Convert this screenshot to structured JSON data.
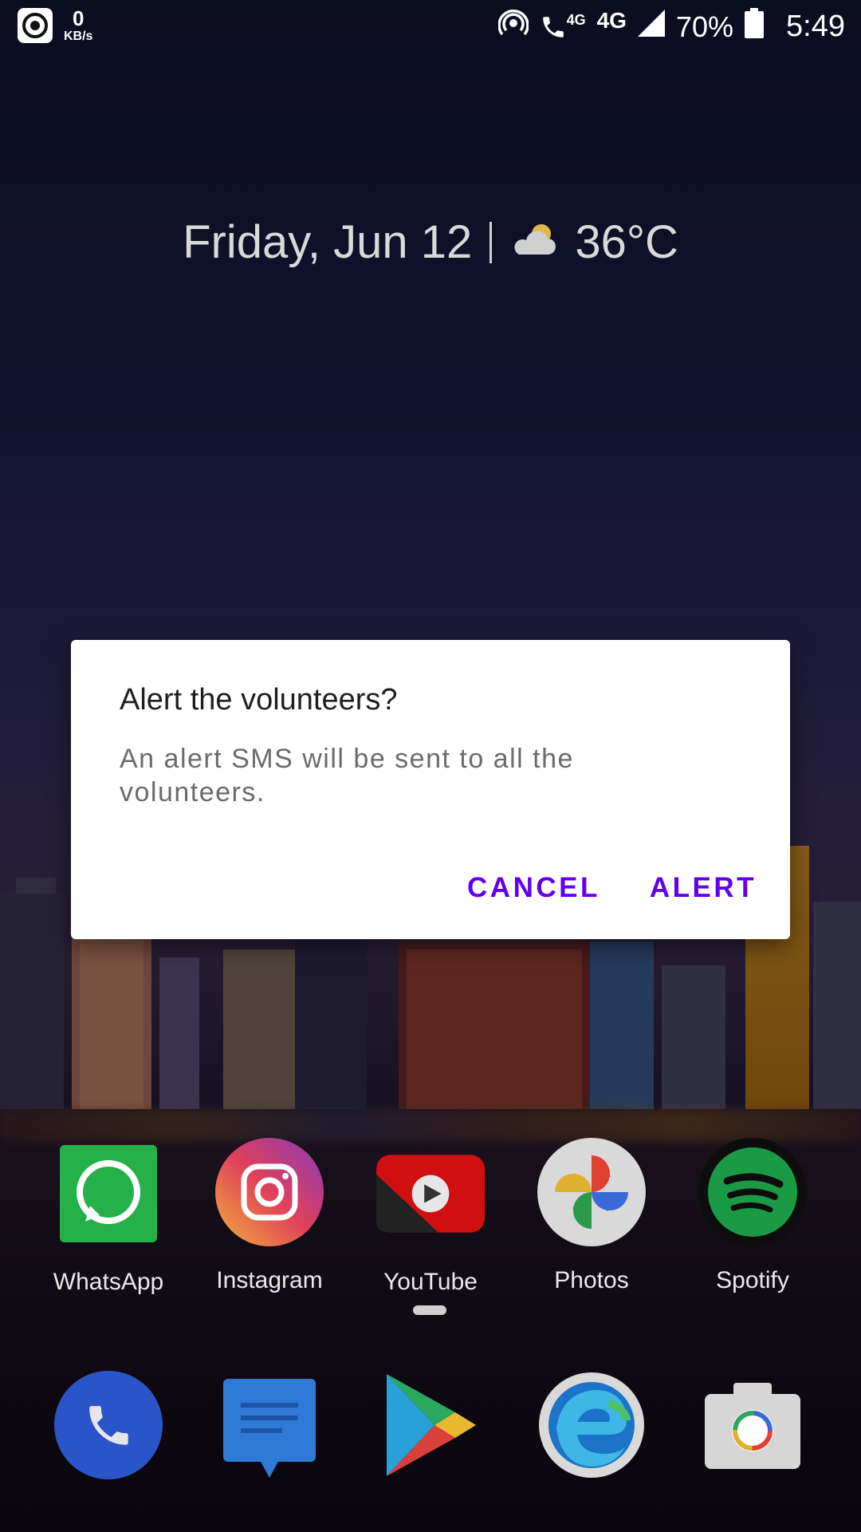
{
  "status_bar": {
    "speed_value": "0",
    "speed_unit": "KB/s",
    "call_net": "4G",
    "network": "4G",
    "battery": "70%",
    "time": "5:49"
  },
  "widget": {
    "date": "Friday, Jun 12",
    "temperature": "36°C",
    "weather_icon": "partly-cloudy-icon"
  },
  "dialog": {
    "title": "Alert the volunteers?",
    "message": "An alert SMS will be sent to all the volunteers.",
    "cancel_label": "CANCEL",
    "confirm_label": "ALERT",
    "accent_color": "#6200ee"
  },
  "home_apps": [
    {
      "label": "WhatsApp",
      "icon": "whatsapp-icon"
    },
    {
      "label": "Instagram",
      "icon": "instagram-icon"
    },
    {
      "label": "YouTube",
      "icon": "youtube-icon"
    },
    {
      "label": "Photos",
      "icon": "photos-icon"
    },
    {
      "label": "Spotify",
      "icon": "spotify-icon"
    }
  ],
  "dock_apps": [
    {
      "icon": "phone-icon"
    },
    {
      "icon": "messages-icon"
    },
    {
      "icon": "play-store-icon"
    },
    {
      "icon": "edge-icon"
    },
    {
      "icon": "camera-icon"
    }
  ]
}
